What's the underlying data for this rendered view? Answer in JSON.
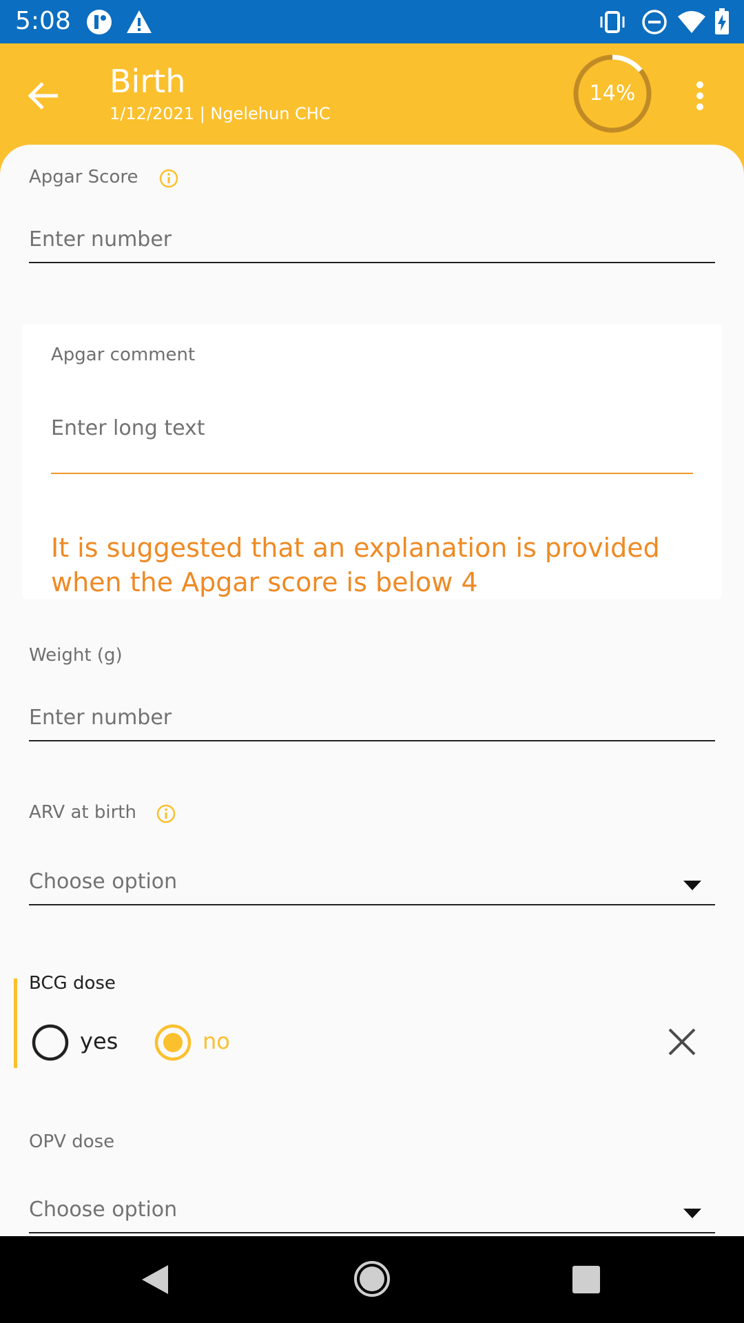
{
  "status_bar": {
    "time": "5:08",
    "icons": [
      "app-notification-icon",
      "warning-icon",
      "vibrate-icon",
      "do-not-disturb-icon",
      "wifi-icon",
      "battery-charging-icon"
    ]
  },
  "toolbar": {
    "title": "Birth",
    "subtitle": "1/12/2021 | Ngelehun CHC",
    "progress_label": "14%",
    "progress_value": 0.14,
    "accent_color": "#fbc02d"
  },
  "form": {
    "apgar_score": {
      "label": "Apgar Score",
      "placeholder": "Enter number"
    },
    "apgar_comment": {
      "label": "Apgar comment",
      "placeholder": "Enter long text",
      "warning": "It is suggested that an explanation is provided when the Apgar score is below 4"
    },
    "weight": {
      "label": "Weight (g)",
      "placeholder": "Enter number"
    },
    "arv_at_birth": {
      "label": "ARV at birth",
      "placeholder": "Choose option"
    },
    "bcg_dose": {
      "label": "BCG dose",
      "options": [
        {
          "label": "yes",
          "selected": false
        },
        {
          "label": "no",
          "selected": true
        }
      ]
    },
    "opv_dose": {
      "label": "OPV dose",
      "placeholder": "Choose option"
    }
  },
  "colors": {
    "status_bar": "#0b6ec0",
    "warning": "#ee8a24",
    "selected": "#fbc02d"
  }
}
